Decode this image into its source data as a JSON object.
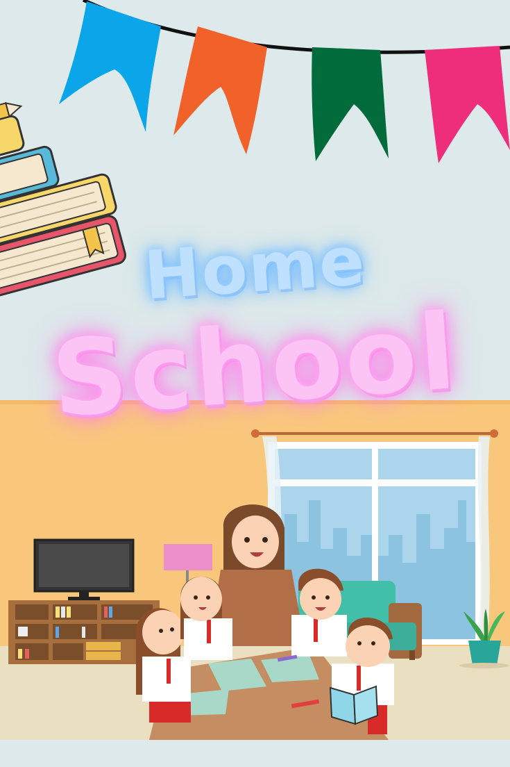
{
  "poster": {
    "title_line1": "Home",
    "title_line2": "School"
  },
  "colors": {
    "background": "#dde9ea",
    "wall": "#f9c77c",
    "floor": "#eadfc0",
    "flag_blue": "#0aa6e9",
    "flag_orange": "#f0622a",
    "flag_green": "#026b3c",
    "flag_pink": "#ee2d7b",
    "title_home_glow": "#7cc0ff",
    "title_school_glow": "#ff8cee"
  },
  "icons": [
    "bunting-flags",
    "book-stack",
    "pencil-icon",
    "television",
    "bookshelf",
    "floor-lamp",
    "window",
    "sofa",
    "potted-plant",
    "teacher",
    "student",
    "table",
    "open-book"
  ]
}
